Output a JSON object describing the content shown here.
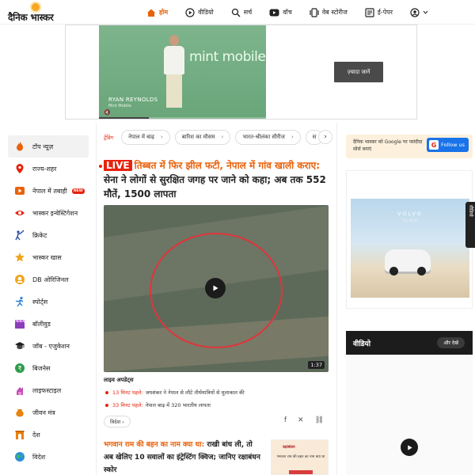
{
  "header": {
    "logo_text": "दैनिक भास्कर",
    "nav": [
      {
        "label": "होम",
        "icon": "home-icon",
        "active": true
      },
      {
        "label": "वीडियो",
        "icon": "play-circle-icon"
      },
      {
        "label": "सर्च",
        "icon": "search-icon"
      },
      {
        "label": "वॉच",
        "icon": "youtube-icon"
      },
      {
        "label": "वेब स्टोरीज",
        "icon": "web-stories-icon"
      },
      {
        "label": "ई-पेपर",
        "icon": "epaper-icon"
      },
      {
        "label": "",
        "icon": "user-icon"
      }
    ]
  },
  "ad": {
    "brand": "mint mobile",
    "person_name": "RYAN REYNOLDS",
    "person_sub": "Mint Mobile",
    "cta": "ज़्यादा जानें"
  },
  "sidebar": {
    "items": [
      {
        "label": "टॉप न्यूज़",
        "icon": "fire-icon",
        "active": true
      },
      {
        "label": "राज्य-शहर",
        "icon": "location-pin-icon"
      },
      {
        "label": "नेपाल में तबाही",
        "icon": "video-play-icon",
        "badge": "NEW"
      },
      {
        "label": "भास्कर इन्वेस्टिगेशन",
        "icon": "eye-icon"
      },
      {
        "label": "क्रिकेट",
        "icon": "cricket-icon"
      },
      {
        "label": "भास्कर खास",
        "icon": "star-icon"
      },
      {
        "label": "DB ओरिजिनल",
        "icon": "db-original-icon"
      },
      {
        "label": "स्पोर्ट्स",
        "icon": "sports-runner-icon"
      },
      {
        "label": "बॉलीवुड",
        "icon": "clapperboard-icon"
      },
      {
        "label": "जॉब - एजुकेशन",
        "icon": "graduation-cap-icon"
      },
      {
        "label": "बिजनेस",
        "icon": "rupee-coin-icon"
      },
      {
        "label": "लाइफस्टाइल",
        "icon": "lifestyle-icon"
      },
      {
        "label": "जीवन मंत्र",
        "icon": "pot-icon"
      },
      {
        "label": "देश",
        "icon": "india-gate-icon"
      },
      {
        "label": "विदेश",
        "icon": "globe-icon"
      }
    ]
  },
  "trending": {
    "label": "ट्रेंडिंग",
    "chips": [
      "नेपाल में बाढ़",
      "बारिश का मौसम",
      "भारत-श्रीलंका सीरीज",
      "स"
    ]
  },
  "story": {
    "live": "LIVE",
    "headline_accent": "तिब्बत में फिर झील फटी, नेपाल में गांव खाली कराए:",
    "headline_rest": " सेना ने लोगों से सुरक्षित जगह पर जाने को कहा; अब तक 552 मौतें, 1500 लापता",
    "video_duration": "1:37",
    "live_updates_label": "लाइव अपडेट्स",
    "updates": [
      {
        "time": "13 मिनट पहले:",
        "text": "जयशंकर ने नेपाल से लौटे तीर्थयात्रियों से मुलाकात की"
      },
      {
        "time": "33 मिनट पहले:",
        "text": "नेपाल बाढ़ में 320 भारतीय लापता"
      }
    ],
    "category": "विदेश"
  },
  "story2": {
    "headline_accent": "भगवान राम की बहन का नाम क्या था:",
    "headline_rest": " राखी बांध ली, तो अब खेलिए 10 सवालों का इंट्रेस्टिंग क्विज; जानिए रक्षाबंधन स्कोर",
    "thumb_title": "रक्षाबंधन",
    "thumb_text": "भगवान राम की बहन का नाम क्या था"
  },
  "right": {
    "google_text": "दैनिक भास्कर को Google पर पसंदीदा सोर्स बनाएं",
    "follow_label": "Follow us",
    "car_brand": "VOLVO",
    "car_sub": "The XC40",
    "side_tab": "वीडियो",
    "video_title": "वीडियो",
    "video_more": "और देखें"
  },
  "colors": {
    "accent": "#e8620c",
    "live_red": "#e8220c",
    "google_blue": "#1a73e8"
  }
}
